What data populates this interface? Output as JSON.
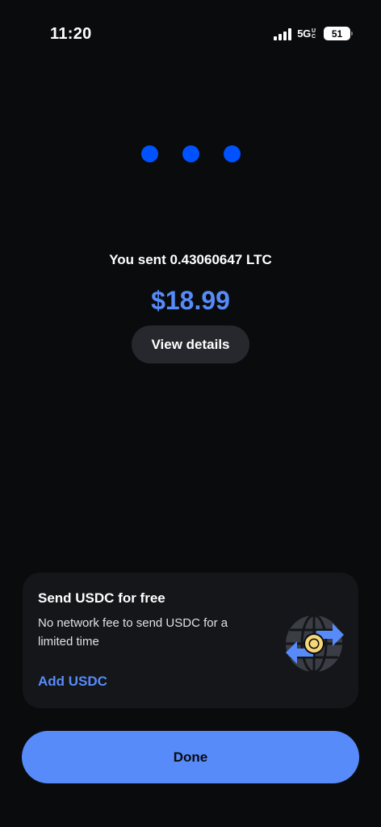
{
  "status_bar": {
    "time": "11:20",
    "network": "5G",
    "network_sub": "UC",
    "battery": "51",
    "icons": [
      "signal-icon",
      "battery-icon"
    ]
  },
  "transaction": {
    "sent_text": "You sent 0.43060647 LTC",
    "amount": "$18.99",
    "details_label": "View details"
  },
  "promo": {
    "title": "Send USDC for free",
    "description": "No network fee to send USDC for a limited time",
    "link_label": "Add USDC",
    "illustration_icon": "globe-transfer-icon"
  },
  "actions": {
    "done_label": "Done"
  },
  "colors": {
    "background": "#0a0b0d",
    "accent": "#578bfa",
    "loading_dot": "#0052ff",
    "card": "#141619",
    "pill": "#26282d"
  }
}
